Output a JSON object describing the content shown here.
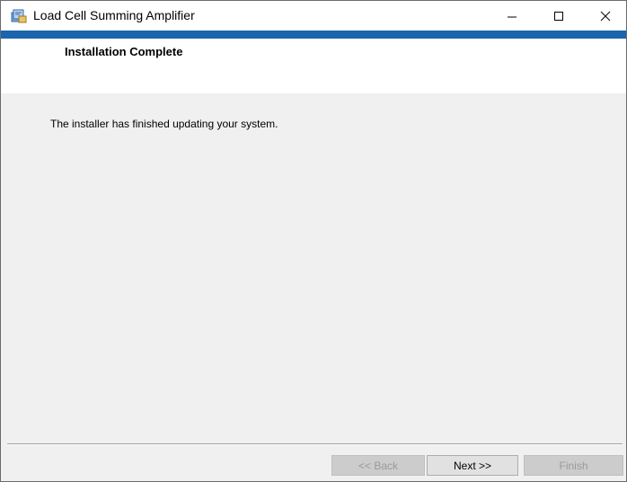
{
  "window": {
    "title": "Load Cell Summing Amplifier",
    "app_icon": "installer-icon",
    "controls": {
      "minimize": "minimize-icon",
      "maximize": "maximize-icon",
      "close": "close-icon"
    },
    "accent_color": "#1c64ac"
  },
  "header": {
    "title": "Installation Complete"
  },
  "main": {
    "message": "The installer has finished updating your system."
  },
  "footer": {
    "back_label": "<< Back",
    "next_label": "Next >>",
    "finish_label": "Finish",
    "back_enabled": false,
    "next_enabled": true,
    "finish_enabled": false
  }
}
